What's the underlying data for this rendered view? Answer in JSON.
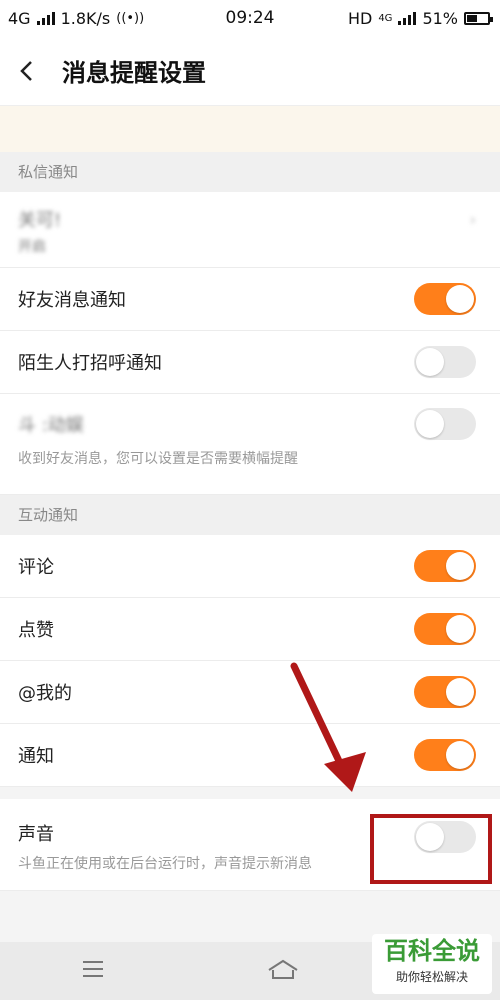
{
  "status_bar": {
    "network": "4G",
    "speed": "1.8K/s",
    "time": "09:24",
    "hd": "HD",
    "net2": "4G",
    "battery": "51%",
    "battery_level": 0.51
  },
  "header": {
    "title": "消息提醒设置"
  },
  "sections": [
    {
      "title": "私信通知",
      "blurred_label": "关可!",
      "blurred_sub": "开启",
      "rows": [
        {
          "label": "好友消息通知",
          "on": true
        },
        {
          "label": "陌生人打招呼通知",
          "on": false
        }
      ],
      "tall_row": {
        "label": "斗 :动娱",
        "on": false,
        "desc": "收到好友消息，您可以设置是否需要横幅提醒"
      }
    },
    {
      "title": "互动通知",
      "rows": [
        {
          "label": "评论",
          "on": true
        },
        {
          "label": "点赞",
          "on": true
        },
        {
          "label": "@我的",
          "on": true
        },
        {
          "label": "通知",
          "on": true
        }
      ]
    }
  ],
  "sound": {
    "label": "声音",
    "desc": "斗鱼正在使用或在后台运行时，声音提示新消息",
    "on": false
  },
  "watermark": {
    "main": "百科全说",
    "sub": "助你轻松解决"
  },
  "colors": {
    "toggle_on": "#ff7f1a",
    "toggle_off": "#e8e8e8",
    "annotation": "#b01818"
  }
}
